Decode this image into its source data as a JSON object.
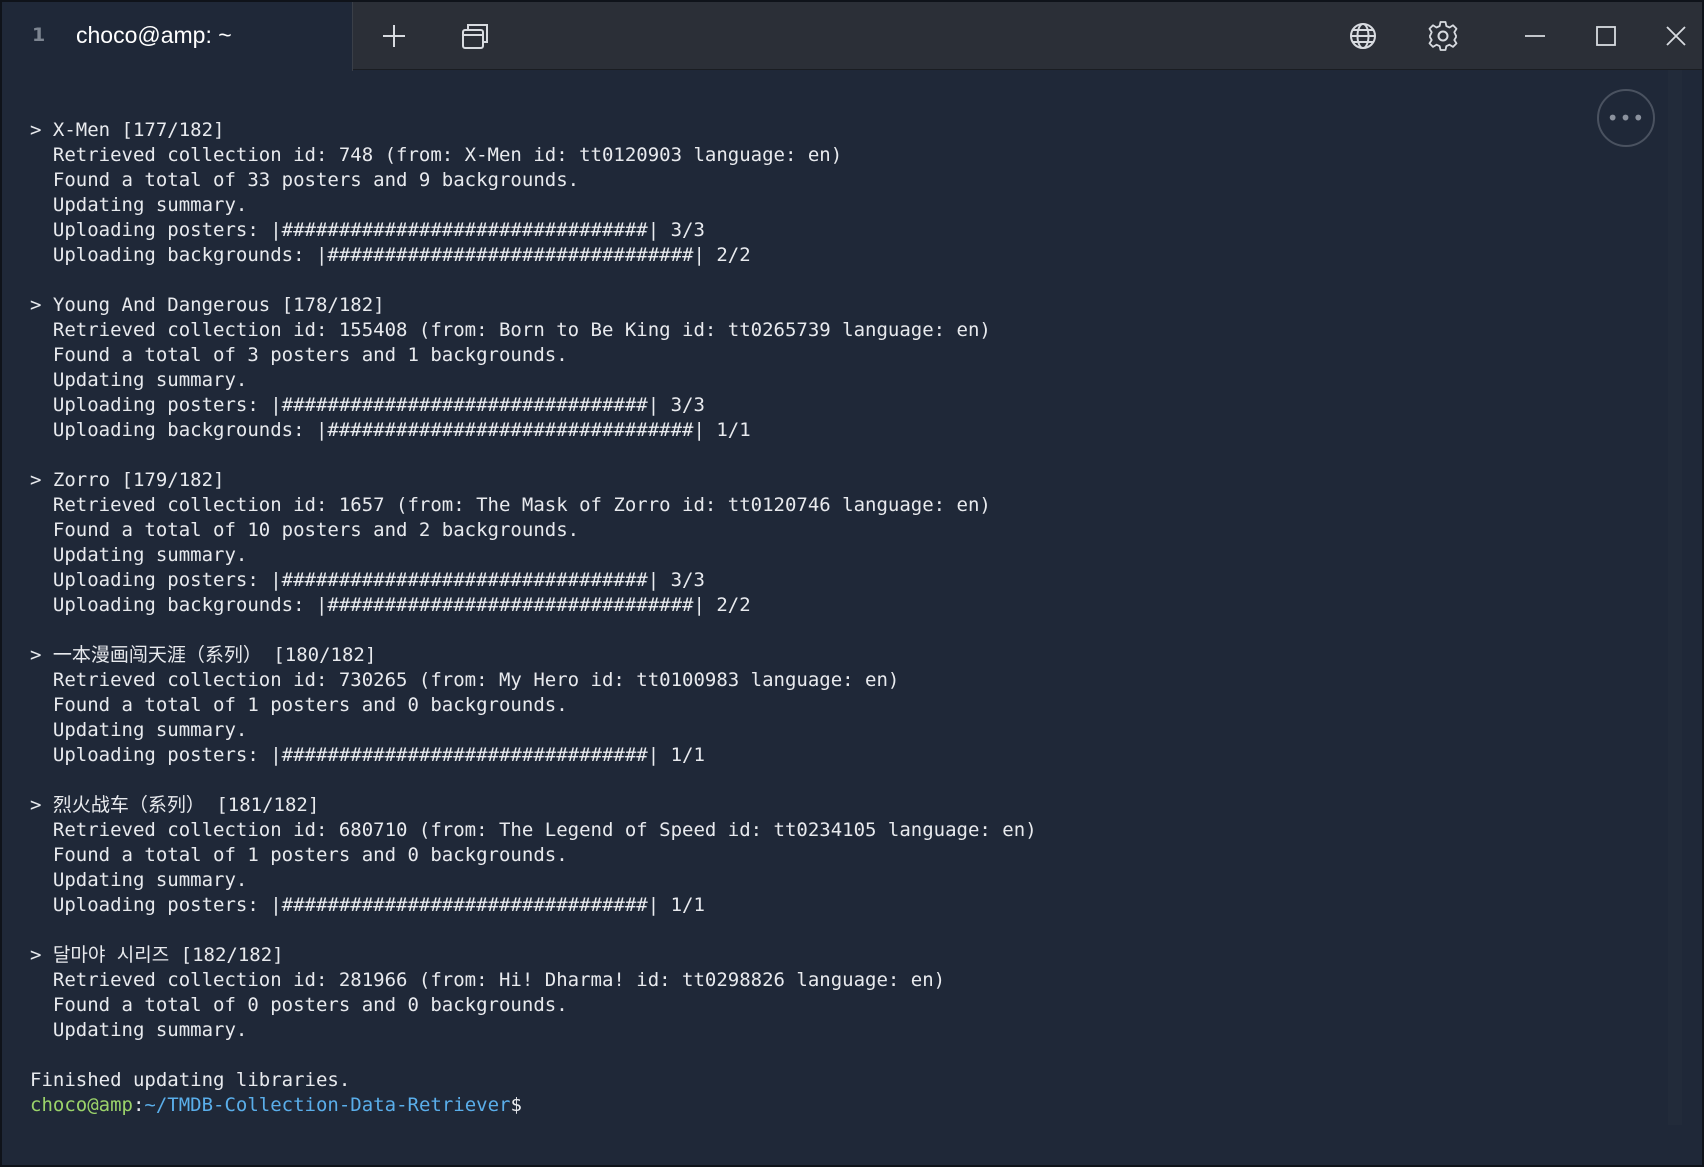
{
  "tab": {
    "index": "1",
    "title": "choco@amp: ~"
  },
  "titlebar_icons": {
    "new_tab": "plus-icon",
    "duplicate": "copy-windows-icon",
    "globe": "globe-icon",
    "settings": "gear-icon",
    "minimize": "minimize-icon",
    "maximize": "maximize-icon",
    "close": "close-icon"
  },
  "more_button_label": "•••",
  "terminal": {
    "lines": [
      "> X-Men [177/182]",
      "  Retrieved collection id: 748 (from: X-Men id: tt0120903 language: en)",
      "  Found a total of 33 posters and 9 backgrounds.",
      "  Updating summary.",
      "  Uploading posters: |################################| 3/3",
      "  Uploading backgrounds: |################################| 2/2",
      "",
      "> Young And Dangerous [178/182]",
      "  Retrieved collection id: 155408 (from: Born to Be King id: tt0265739 language: en)",
      "  Found a total of 3 posters and 1 backgrounds.",
      "  Updating summary.",
      "  Uploading posters: |################################| 3/3",
      "  Uploading backgrounds: |################################| 1/1",
      "",
      "> Zorro [179/182]",
      "  Retrieved collection id: 1657 (from: The Mask of Zorro id: tt0120746 language: en)",
      "  Found a total of 10 posters and 2 backgrounds.",
      "  Updating summary.",
      "  Uploading posters: |################################| 3/3",
      "  Uploading backgrounds: |################################| 2/2",
      "",
      "> 一本漫画闯天涯（系列） [180/182]",
      "  Retrieved collection id: 730265 (from: My Hero id: tt0100983 language: en)",
      "  Found a total of 1 posters and 0 backgrounds.",
      "  Updating summary.",
      "  Uploading posters: |################################| 1/1",
      "",
      "> 烈火战车（系列） [181/182]",
      "  Retrieved collection id: 680710 (from: The Legend of Speed id: tt0234105 language: en)",
      "  Found a total of 1 posters and 0 backgrounds.",
      "  Updating summary.",
      "  Uploading posters: |################################| 1/1",
      "",
      "> 달마야 시리즈 [182/182]",
      "  Retrieved collection id: 281966 (from: Hi! Dharma! id: tt0298826 language: en)",
      "  Found a total of 0 posters and 0 backgrounds.",
      "  Updating summary.",
      "",
      "Finished updating libraries."
    ],
    "prompt": {
      "user": "choco@amp",
      "separator": ":",
      "path": "~/TMDB-Collection-Data-Retriever",
      "sign": "$"
    }
  },
  "colors": {
    "background": "#1f2838",
    "titlebar": "#2b2f37",
    "prompt_user": "#9bd36a",
    "prompt_path": "#5aaeea"
  }
}
